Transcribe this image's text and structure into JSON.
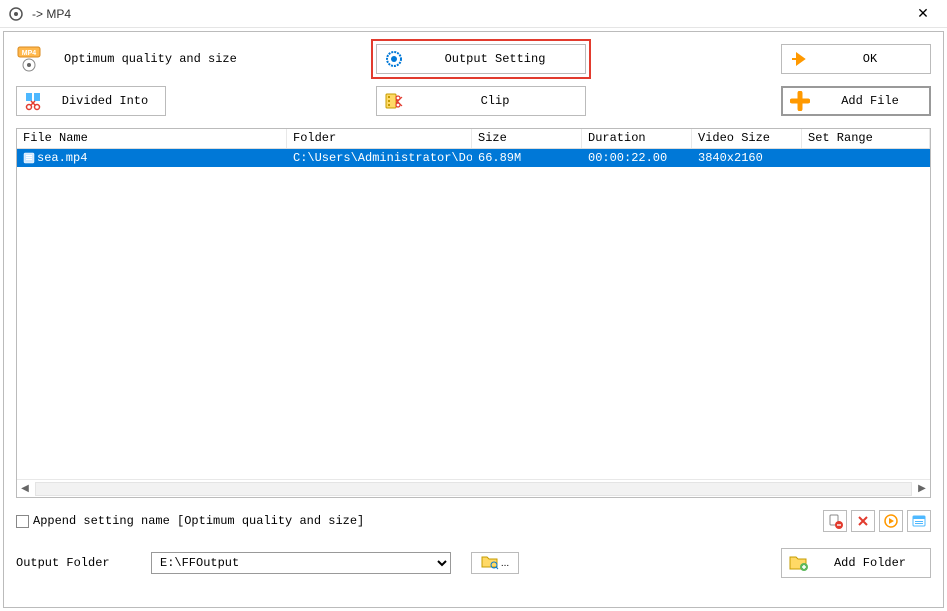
{
  "window": {
    "title": "-> MP4"
  },
  "top": {
    "quality_text": "Optimum quality and size",
    "output_setting": "Output Setting",
    "ok": "OK",
    "divided_into": "Divided Into",
    "clip": "Clip",
    "add_file": "Add File"
  },
  "table": {
    "headers": {
      "filename": "File Name",
      "folder": "Folder",
      "size": "Size",
      "duration": "Duration",
      "videosize": "Video Size",
      "setrange": "Set Range"
    },
    "rows": [
      {
        "filename": "sea.mp4",
        "folder": "C:\\Users\\Administrator\\Downloads",
        "size": "66.89M",
        "duration": "00:00:22.00",
        "videosize": "3840x2160",
        "setrange": ""
      }
    ]
  },
  "append_setting_label": "Append setting name [Optimum quality and size]",
  "output": {
    "label": "Output Folder",
    "value": "E:\\FFOutput",
    "browse_dots": "...",
    "add_folder": "Add Folder"
  }
}
